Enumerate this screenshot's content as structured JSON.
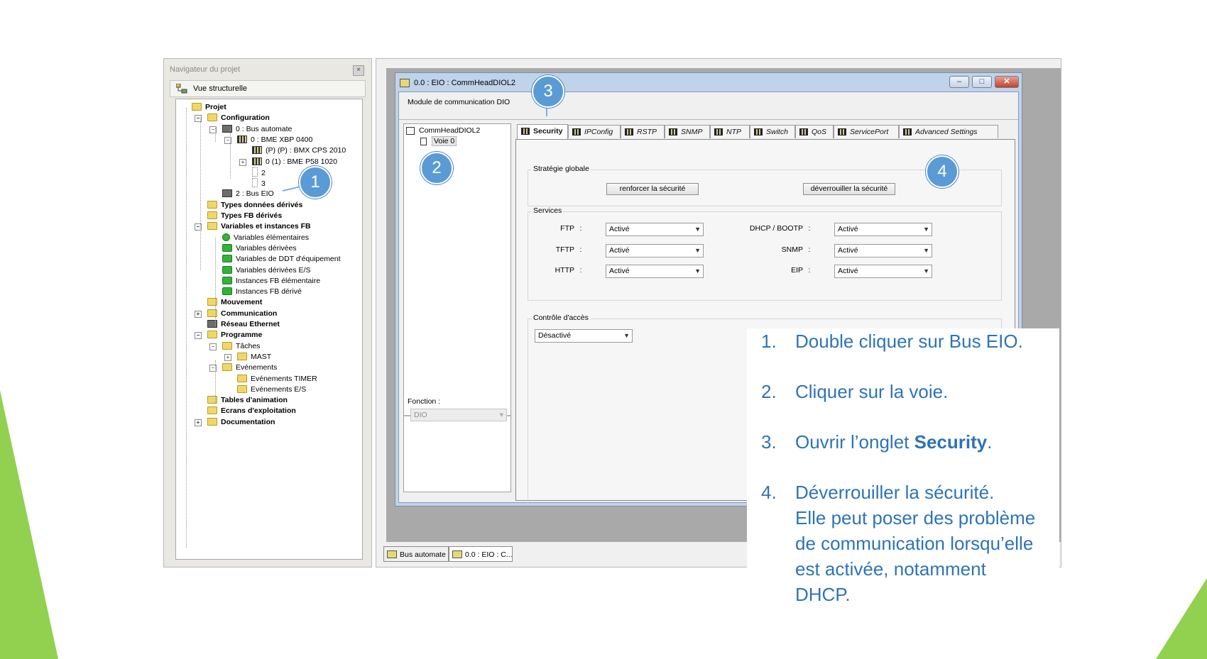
{
  "navigator": {
    "title": "Navigateur du projet",
    "close_glyph": "×",
    "view_label": "Vue structurelle",
    "tree": [
      {
        "label": "Projet",
        "bold": true,
        "icon": "folder-open-icon"
      },
      {
        "label": "Configuration",
        "bold": true,
        "icon": "folder-open-icon"
      },
      {
        "label": "0 : Bus automate",
        "bold": false,
        "icon": "network-icon"
      },
      {
        "label": "0 : BME XBP 0400",
        "bold": false,
        "icon": "rack-icon"
      },
      {
        "label": "(P) (P) : BMX CPS 2010",
        "bold": false,
        "icon": "module-icon"
      },
      {
        "label": "0 (1) : BME P58 1020",
        "bold": false,
        "icon": "module-icon"
      },
      {
        "label": "2",
        "bold": false,
        "icon": "empty-slot-icon"
      },
      {
        "label": "3",
        "bold": false,
        "icon": "empty-slot-icon"
      },
      {
        "label": "2 : Bus EIO",
        "bold": false,
        "icon": "network-icon"
      },
      {
        "label": "Types données dérivés",
        "bold": true,
        "icon": "folder-icon"
      },
      {
        "label": "Types FB dérivés",
        "bold": true,
        "icon": "folder-icon"
      },
      {
        "label": "Variables et instances FB",
        "bold": true,
        "icon": "folder-open-icon"
      },
      {
        "label": "Variables élémentaires",
        "bold": false,
        "icon": "green-dot-icon"
      },
      {
        "label": "Variables dérivées",
        "bold": false,
        "icon": "green-block-icon"
      },
      {
        "label": "Variables de DDT d'équipement",
        "bold": false,
        "icon": "green-block-icon"
      },
      {
        "label": "Variables dérivées E/S",
        "bold": false,
        "icon": "green-block-icon"
      },
      {
        "label": "Instances FB élémentaire",
        "bold": false,
        "icon": "green-block-icon"
      },
      {
        "label": "Instances FB dérivé",
        "bold": false,
        "icon": "green-block-icon"
      },
      {
        "label": "Mouvement",
        "bold": true,
        "icon": "folder-icon"
      },
      {
        "label": "Communication",
        "bold": true,
        "icon": "folder-icon"
      },
      {
        "label": "Réseau Ethernet",
        "bold": true,
        "icon": "network-icon"
      },
      {
        "label": "Programme",
        "bold": true,
        "icon": "folder-open-icon"
      },
      {
        "label": "Tâches",
        "bold": false,
        "icon": "folder-open-icon"
      },
      {
        "label": "MAST",
        "bold": false,
        "icon": "folder-icon"
      },
      {
        "label": "Evénements",
        "bold": false,
        "icon": "folder-open-icon"
      },
      {
        "label": "Evénements TIMER",
        "bold": false,
        "icon": "folder-icon"
      },
      {
        "label": "Evénements E/S",
        "bold": false,
        "icon": "folder-icon"
      },
      {
        "label": "Tables d'animation",
        "bold": true,
        "icon": "folder-icon"
      },
      {
        "label": "Ecrans d'exploitation",
        "bold": true,
        "icon": "folder-icon"
      },
      {
        "label": "Documentation",
        "bold": true,
        "icon": "documentation-icon"
      }
    ]
  },
  "dialog": {
    "title": "0.0 : EIO : CommHeadDIOL2",
    "minimize_glyph": "–",
    "maximize_glyph": "□",
    "close_glyph": "✕",
    "module_label": "Module de communication DIO",
    "module_name": "CommHeadDIOL2",
    "channel": "Voie 0",
    "fonction_label": "Fonction :",
    "fonction_value": "DIO",
    "tabs": [
      "Security",
      "IPConfig",
      "RSTP",
      "SNMP",
      "NTP",
      "Switch",
      "QoS",
      "ServicePort",
      "Advanced Settings"
    ],
    "active_tab": "Security",
    "strategie": {
      "label": "Stratégie globale",
      "enforce_button": "renforcer la sécurité",
      "unlock_button": "déverrouiller la sécurité"
    },
    "services": {
      "label": "Services",
      "items": [
        {
          "name": "FTP",
          "value": "Activé"
        },
        {
          "name": "TFTP",
          "value": "Activé"
        },
        {
          "name": "HTTP",
          "value": "Activé"
        },
        {
          "name": "DHCP / BOOTP",
          "value": "Activé"
        },
        {
          "name": "SNMP",
          "value": "Activé"
        },
        {
          "name": "EIP",
          "value": "Activé"
        }
      ],
      "separator": ":"
    },
    "access": {
      "label": "Contrôle d'accès",
      "value": "Désactivé"
    }
  },
  "taskbar": [
    "Bus automate",
    "0.0 : EIO : C..."
  ],
  "callouts": [
    "1",
    "2",
    "3",
    "4"
  ],
  "instructions": [
    {
      "num": "1.",
      "text": "Double cliquer sur Bus EIO."
    },
    {
      "num": "2.",
      "text": "Cliquer sur la voie."
    },
    {
      "num": "3.",
      "pre": "Ouvrir l’onglet ",
      "bold": "Security",
      "post": "."
    },
    {
      "num": "4.",
      "text": "Déverrouiller la sécurité.",
      "sub": [
        "Elle peut poser des problème",
        "de communication lorsqu’elle",
        "est activée, notamment",
        "DHCP."
      ]
    }
  ],
  "colors": {
    "accent": "#5b9bd5",
    "instruction_text": "#2e74b5",
    "decor_green": "#92d050"
  }
}
